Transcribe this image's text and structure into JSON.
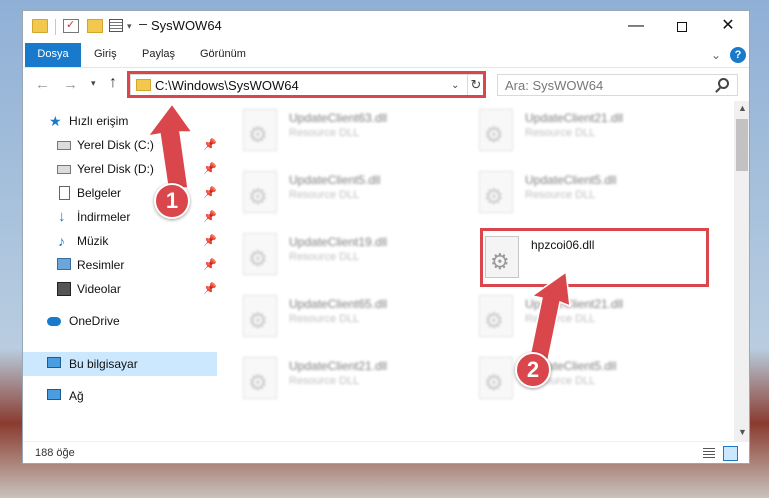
{
  "window": {
    "title": "SysWOW64",
    "minimize_glyph": "—",
    "close_glyph": "✕"
  },
  "ribbon": {
    "tabs": [
      "Dosya",
      "Giriş",
      "Paylaş",
      "Görünüm"
    ],
    "help_glyph": "?"
  },
  "address": {
    "path": "C:\\Windows\\SysWOW64",
    "search_placeholder": "Ara: SysWOW64"
  },
  "nav": {
    "quick_access": "Hızlı erişim",
    "items": [
      {
        "label": "Yerel Disk (C:)",
        "icon": "drive-icon",
        "pinned": true
      },
      {
        "label": "Yerel Disk (D:)",
        "icon": "drive-icon",
        "pinned": true
      },
      {
        "label": "Belgeler",
        "icon": "documents-icon",
        "pinned": true
      },
      {
        "label": "İndirmeler",
        "icon": "download-icon",
        "pinned": true
      },
      {
        "label": "Müzik",
        "icon": "music-icon",
        "pinned": true
      },
      {
        "label": "Resimler",
        "icon": "pictures-icon",
        "pinned": true
      },
      {
        "label": "Videolar",
        "icon": "videos-icon",
        "pinned": true
      }
    ],
    "onedrive": "OneDrive",
    "this_pc": "Bu bilgisayar",
    "network": "Ağ"
  },
  "files": [
    {
      "name": "UpdateClient63.dll",
      "type": "Resource DLL",
      "blurred": true
    },
    {
      "name": "UpdateClient21.dll",
      "type": "Resource DLL",
      "blurred": true
    },
    {
      "name": "UpdateClient5.dll",
      "type": "Resource DLL",
      "blurred": true
    },
    {
      "name": "UpdateClient5.dll",
      "type": "Resource DLL",
      "blurred": true
    },
    {
      "name": "UpdateClient19.dll",
      "type": "Resource DLL",
      "blurred": true
    },
    {
      "name": "hpzcoi06.dll",
      "type": "",
      "blurred": false
    },
    {
      "name": "UpdateClient65.dll",
      "type": "Resource DLL",
      "blurred": true
    },
    {
      "name": "UpdateClient21.dll",
      "type": "Resource DLL",
      "blurred": true
    },
    {
      "name": "UpdateClient21.dll",
      "type": "Resource DLL",
      "blurred": true
    },
    {
      "name": "UpdateClient5.dll",
      "type": "Resource DLL",
      "blurred": true
    }
  ],
  "status": {
    "item_count": "188 öğe"
  },
  "callouts": [
    "1",
    "2"
  ],
  "colors": {
    "accent": "#1979ca",
    "highlight": "#d9464b"
  }
}
